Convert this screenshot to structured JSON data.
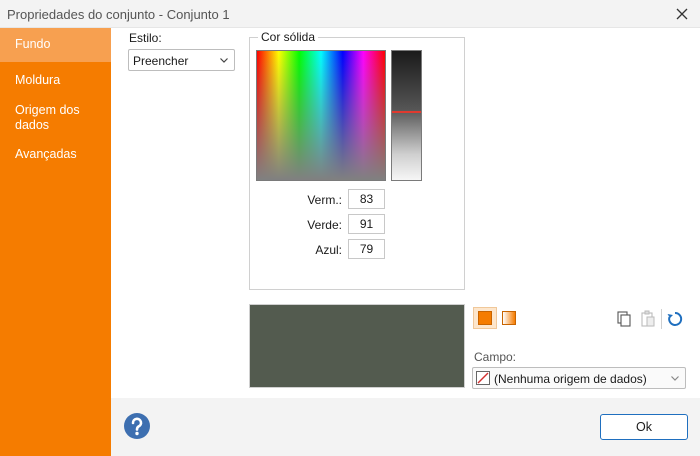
{
  "window": {
    "title": "Propriedades do conjunto - Conjunto 1"
  },
  "sidebar": {
    "items": [
      {
        "label": "Fundo",
        "active": true
      },
      {
        "label": "Moldura"
      },
      {
        "label": "Origem dos dados"
      },
      {
        "label": "Avançadas"
      }
    ]
  },
  "style": {
    "label": "Estilo:",
    "value": "Preencher"
  },
  "solid_color": {
    "group_title": "Cor sólida",
    "red": {
      "label": "Verm.:",
      "value": "83"
    },
    "green": {
      "label": "Verde:",
      "value": "91"
    },
    "blue": {
      "label": "Azul:",
      "value": "79"
    },
    "current_color": "#535b4f",
    "luminance_level": 0.47
  },
  "field": {
    "label": "Campo:",
    "value": "(Nenhuma origem de dados)"
  },
  "buttons": {
    "ok": "Ok"
  },
  "colors": {
    "accent": "#f57c00",
    "accent_light": "#f7a050",
    "selection": "#1f6fbf"
  }
}
